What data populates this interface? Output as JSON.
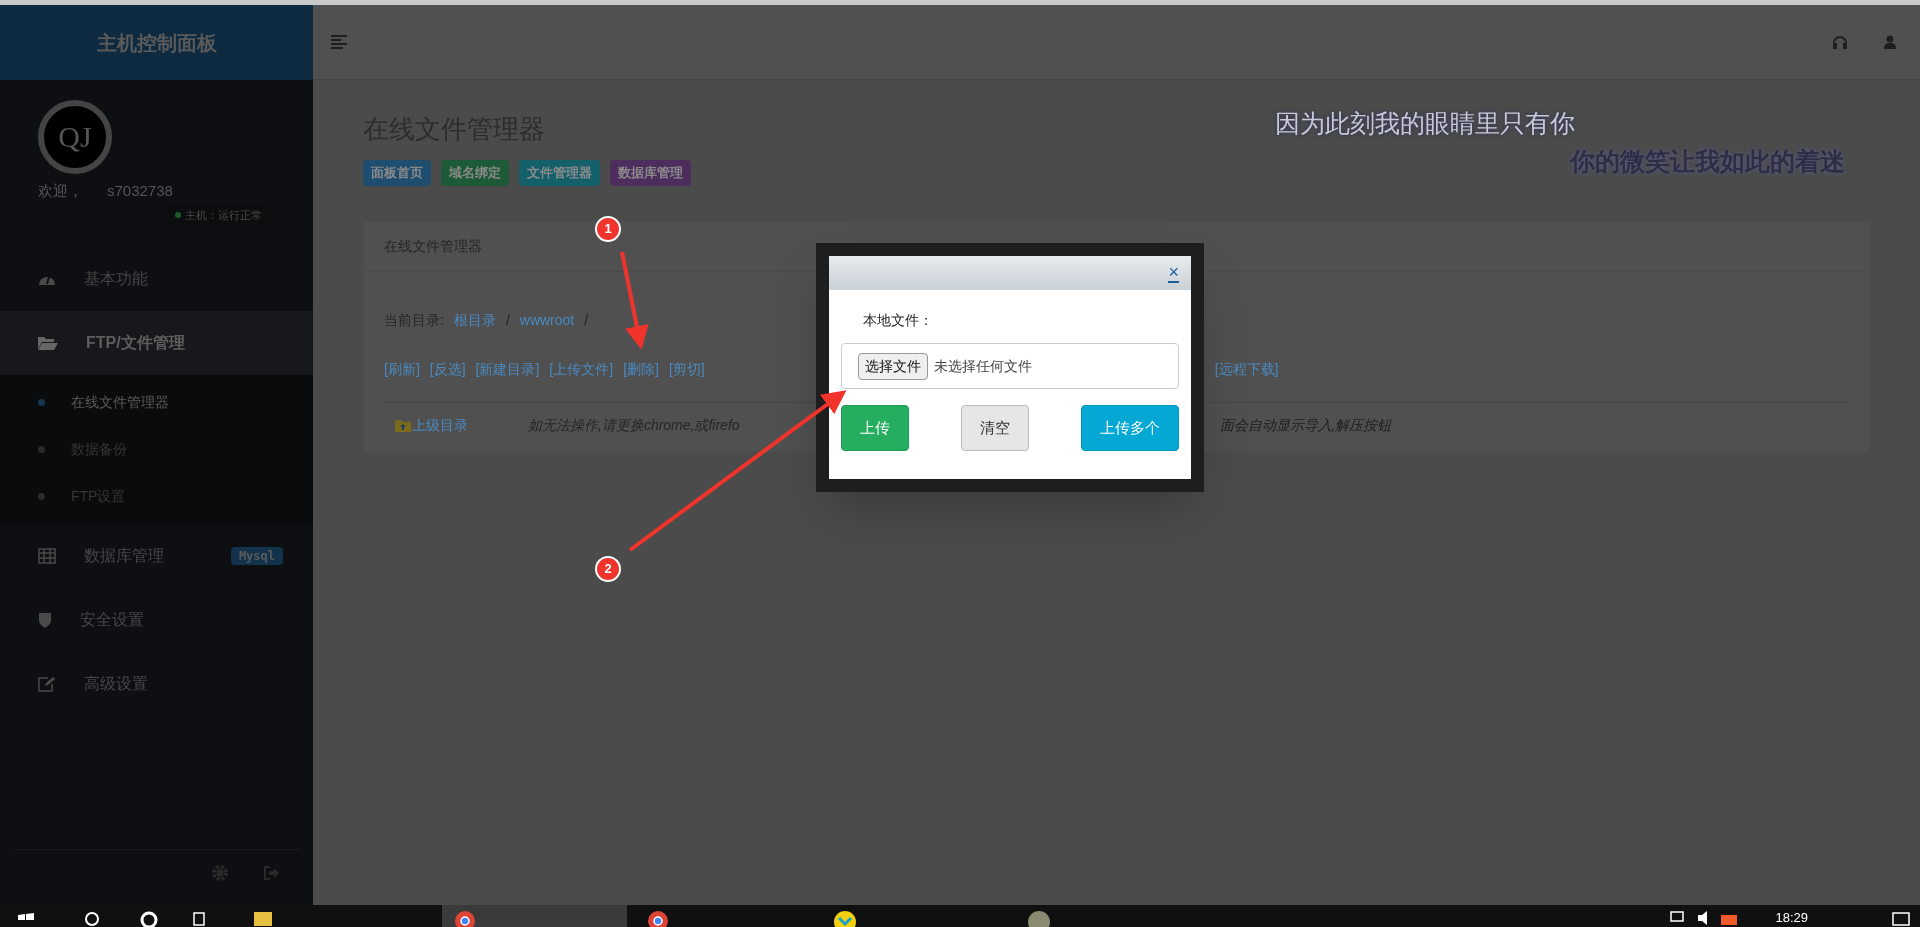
{
  "sidebar": {
    "brand": "主机控制面板",
    "avatar": "QJ",
    "welcome": "欢迎，",
    "username": "s7032738",
    "host_status": "主机：运行正常",
    "menu": [
      {
        "label": "基本功能",
        "selected": false
      },
      {
        "label": "FTP/文件管理",
        "selected": true,
        "expanded": true,
        "children": [
          {
            "label": "在线文件管理器",
            "selected": true
          },
          {
            "label": "数据备份",
            "selected": false
          },
          {
            "label": "FTP设置",
            "selected": false
          }
        ]
      },
      {
        "label": "数据库管理",
        "selected": false,
        "badge": "Mysql"
      },
      {
        "label": "安全设置",
        "selected": false
      },
      {
        "label": "高级设置",
        "selected": false
      }
    ]
  },
  "page": {
    "title": "在线文件管理器",
    "quote_lines": [
      "因为此刻我的眼睛里只有你",
      "你的微笑让我如此的着迷"
    ],
    "shortcuts": [
      {
        "label": "面板首页",
        "color": "#1f4d70"
      },
      {
        "label": "域名绑定",
        "color": "#1d5a37"
      },
      {
        "label": "文件管理器",
        "color": "#13606b"
      },
      {
        "label": "数据库管理",
        "color": "#4d2c5e"
      }
    ],
    "panel": {
      "title": "在线文件管理器",
      "path_label": "当前目录:",
      "path": [
        "根目录",
        "wwwroot"
      ],
      "path_separator": "/",
      "actions_left": [
        "[刷新]",
        "[反选]",
        "[新建目录]",
        "[上传文件]",
        "[删除]",
        "[剪切]"
      ],
      "actions_right": [
        "[远程下载]"
      ],
      "parent_dir": "上级目录",
      "note_left": "如无法操作,请更换chrome,或firefo",
      "note_right": "面会自动显示导入,解压按钮"
    }
  },
  "dialog": {
    "close": "×",
    "label": "本地文件：",
    "choose_button": "选择文件",
    "no_file": "未选择任何文件",
    "buttons": [
      {
        "label": "上传",
        "kind": "success"
      },
      {
        "label": "清空",
        "kind": "default"
      },
      {
        "label": "上传多个",
        "kind": "info"
      }
    ]
  },
  "annotations": [
    "1",
    "2"
  ],
  "taskbar": {
    "time": "18:29"
  }
}
